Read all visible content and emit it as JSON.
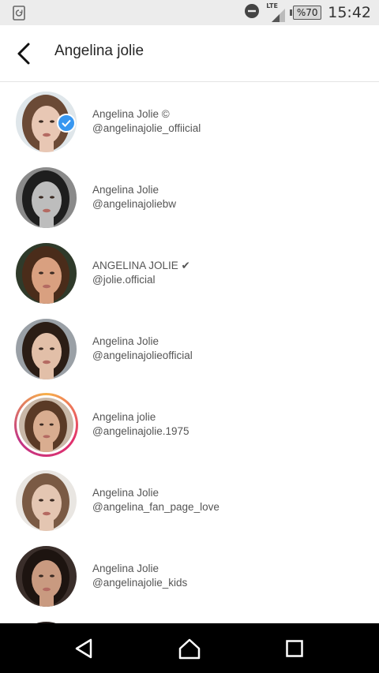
{
  "status_bar": {
    "network_label": "LTE",
    "battery_text": "%70",
    "time": "15:42"
  },
  "header": {
    "title": "Angelina jolie",
    "back_icon": "chevron-left-icon"
  },
  "results": [
    {
      "name": "Angelina Jolie ©",
      "handle": "@angelinajolie_offiicial",
      "verified": true,
      "story_ring": false,
      "skin": "#e8c7b4",
      "hair": "#6b4a36",
      "bg": "#dfe6ea"
    },
    {
      "name": "Angelina Jolie",
      "handle": "@angelinajoliebw",
      "verified": false,
      "story_ring": false,
      "skin": "#bdbdbd",
      "hair": "#1e1e1e",
      "bg": "#8a8a8a"
    },
    {
      "name": "ANGELINA JOLIE ✔",
      "handle": "@jolie.official",
      "verified": false,
      "story_ring": false,
      "skin": "#d9a080",
      "hair": "#4a2c1a",
      "bg": "#2f3a2a"
    },
    {
      "name": "Angelina Jolie",
      "handle": "@angelinajolieofficial",
      "verified": false,
      "story_ring": false,
      "skin": "#e2bfa8",
      "hair": "#2b1d15",
      "bg": "#9aa0a6"
    },
    {
      "name": "Angelina jolie",
      "handle": "@angelinajolie.1975",
      "verified": false,
      "story_ring": true,
      "skin": "#d9ad90",
      "hair": "#5a3a26",
      "bg": "#c9b8a8"
    },
    {
      "name": "Angelina Jolie",
      "handle": "@angelina_fan_page_love",
      "verified": false,
      "story_ring": false,
      "skin": "#e4c6b2",
      "hair": "#7a5a44",
      "bg": "#e9e6e2"
    },
    {
      "name": "Angelina Jolie",
      "handle": "@angelinajolie_kids",
      "verified": false,
      "story_ring": false,
      "skin": "#c99a80",
      "hair": "#1d1410",
      "bg": "#3a2e2a"
    }
  ],
  "nav_bar": {
    "back": "triangle-back-icon",
    "home": "home-icon",
    "recents": "square-recents-icon"
  }
}
